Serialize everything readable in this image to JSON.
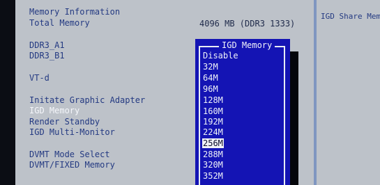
{
  "memory_info": {
    "heading": "Memory Information",
    "total_memory_label": "Total Memory",
    "total_memory_value": "4096 MB (DDR3 1333)",
    "ddr3_a1_label": "DDR3_A1",
    "ddr3_b1_label": "DDR3_B1"
  },
  "settings": {
    "vtd": "VT-d",
    "initiate_graphic_adapter": "Initate Graphic Adapter",
    "igd_memory": "IGD Memory",
    "render_standby": "Render Standby",
    "igd_multi_monitor": "IGD Multi-Monitor",
    "dvmt_mode_select": "DVMT Mode Select",
    "dvmt_fixed_memory": "DVMT/FIXED Memory"
  },
  "help": {
    "text": "IGD Share Memo"
  },
  "popup": {
    "title": "IGD Memory",
    "selected": "256M",
    "options": [
      "Disable",
      "32M",
      "64M",
      "96M",
      "128M",
      "160M",
      "192M",
      "224M",
      "256M",
      "288M",
      "320M",
      "352M"
    ]
  }
}
